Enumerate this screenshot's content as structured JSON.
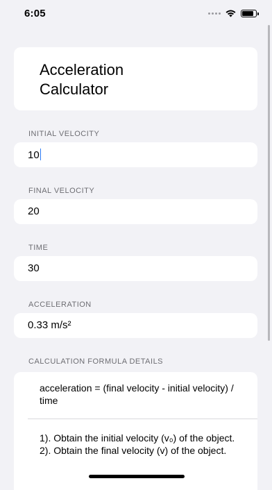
{
  "status": {
    "time": "6:05"
  },
  "header": {
    "title": "Acceleration Calculator"
  },
  "fields": {
    "initial_velocity": {
      "label": "INITIAL VELOCITY",
      "value": "10"
    },
    "final_velocity": {
      "label": "FINAL VELOCITY",
      "value": "20"
    },
    "time": {
      "label": "TIME",
      "value": "30"
    },
    "acceleration": {
      "label": "ACCELERATION",
      "value": "0.33 m/s²"
    }
  },
  "formula": {
    "label": "CALCULATION FORMULA DETAILS",
    "equation": "acceleration = (final velocity - initial velocity) / time",
    "steps": [
      "1). Obtain the initial velocity (v₀) of the object.",
      "2). Obtain the final velocity (v) of the object."
    ]
  },
  "colors": {
    "background": "#f2f2f6",
    "card": "#ffffff",
    "label": "#6d6d72",
    "caret": "#2c7cf6"
  }
}
